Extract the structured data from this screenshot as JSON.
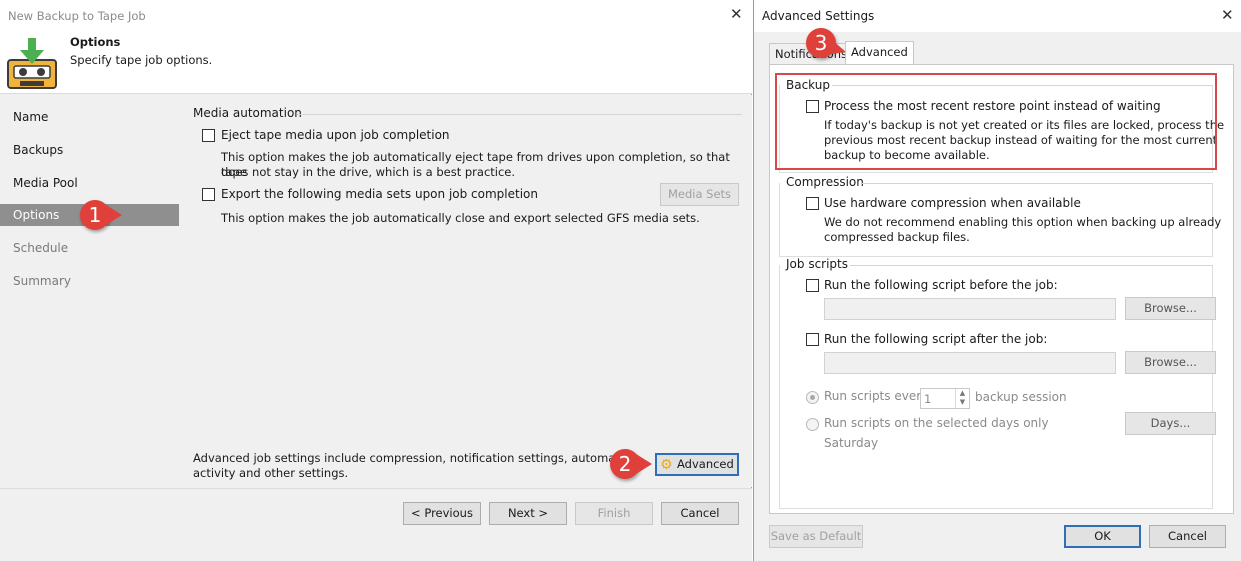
{
  "wizard": {
    "window_title": "New Backup to Tape Job",
    "header": {
      "title": "Options",
      "subtitle": "Specify tape job options."
    },
    "nav": [
      {
        "label": "Name"
      },
      {
        "label": "Backups"
      },
      {
        "label": "Media Pool"
      },
      {
        "label": "Options"
      },
      {
        "label": "Schedule"
      },
      {
        "label": "Summary"
      }
    ],
    "media_automation": {
      "title": "Media automation",
      "eject": {
        "label": "Eject tape media upon job completion",
        "desc_line1": "This option makes the job automatically eject tape from drives upon completion, so that tape",
        "desc_line2": "does not stay in the drive, which is a best practice."
      },
      "export": {
        "label": "Export the following media sets upon job completion",
        "desc": "This option makes the job automatically close and export selected GFS media sets.",
        "button": "Media Sets"
      }
    },
    "advanced_hint_line1": "Advanced job settings include compression, notification settings, automated p",
    "advanced_hint_line2": "activity and other settings.",
    "advanced_button": "Advanced",
    "footer": {
      "previous": "< Previous",
      "next": "Next >",
      "finish": "Finish",
      "cancel": "Cancel"
    }
  },
  "callouts": [
    "1",
    "2",
    "3"
  ],
  "advanced_dialog": {
    "title": "Advanced Settings",
    "tabs": [
      {
        "label": "Notifications"
      },
      {
        "label": "Advanced"
      }
    ],
    "backup": {
      "title": "Backup",
      "checkbox_label": "Process the most recent restore point instead of waiting",
      "desc_line1": "If today's backup is not yet created or its files are locked, process the",
      "desc_line2": "previous most recent backup instead of waiting for the most current",
      "desc_line3": "backup to become available."
    },
    "compression": {
      "title": "Compression",
      "checkbox_label": "Use hardware compression when available",
      "desc_line1": "We do not recommend enabling this option when backing up already",
      "desc_line2": "compressed backup files."
    },
    "job_scripts": {
      "title": "Job scripts",
      "before_label": "Run the following script before the job:",
      "after_label": "Run the following script after the job:",
      "browse": "Browse...",
      "run_every_label": "Run scripts every",
      "run_every_value": "1",
      "run_every_unit": "backup session",
      "run_days_label": "Run scripts on the selected days only",
      "days_button": "Days...",
      "days_value": "Saturday"
    },
    "footer": {
      "save_default": "Save as Default",
      "ok": "OK",
      "cancel": "Cancel"
    }
  },
  "colors": {
    "callout": "#e0403a",
    "highlight": "#d9474a",
    "active_nav": "#8f8f8f",
    "focus": "#2f6fb8"
  }
}
